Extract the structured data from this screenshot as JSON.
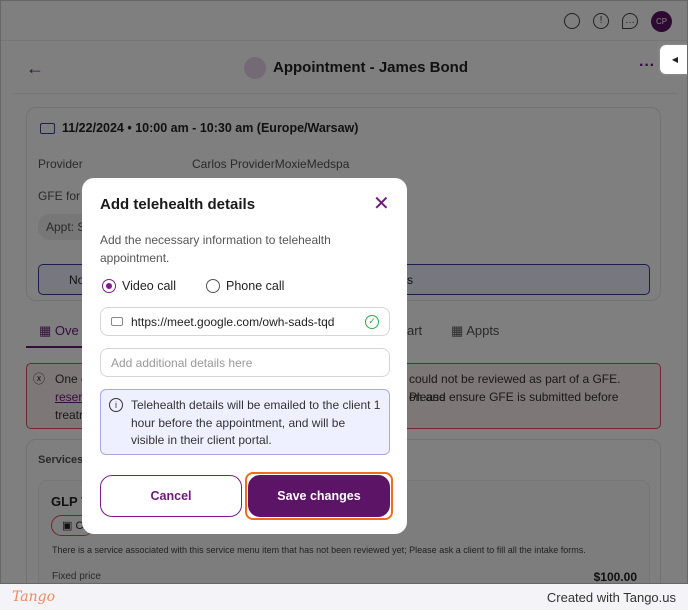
{
  "header": {
    "avatar_initials": "CP",
    "title": "Appointment - James Bond"
  },
  "appointment": {
    "date": "11/22/2024",
    "time": "10:00 am - 10:30 am (Europe/Warsaw)",
    "provider_label": "Provider",
    "provider_value": "Carlos ProviderMoxieMedspa",
    "gfe_label": "GFE for a",
    "appt_chip": "Appt: S",
    "notice_partial": "No",
    "notice_tail": "s"
  },
  "tabs": [
    {
      "label": "Ove"
    },
    {
      "label": "art"
    },
    {
      "label": "Appts"
    }
  ],
  "error": {
    "line1_start": "One c",
    "line1_end": "could not be reviewed as part of a GFE. Please",
    "line2_link": "reser",
    "line2_end": "on and ensure GFE is submitted before",
    "line3": "treatr"
  },
  "services": {
    "heading": "Services &",
    "item": "GLP T",
    "chip": "C",
    "note": "There is a service associated with this service menu item that has not been reviewed yet; Please ask a client to fill all the intake forms.",
    "price_label": "Fixed price",
    "price": "$100.00"
  },
  "modal": {
    "title": "Add telehealth details",
    "description": "Add the necessary information to telehealth appointment.",
    "options": [
      {
        "label": "Video call",
        "selected": true
      },
      {
        "label": "Phone call",
        "selected": false
      }
    ],
    "url_value": "https://meet.google.com/owh-sads-tqd",
    "details_placeholder": "Add additional details here",
    "info": "Telehealth details will be emailed to the client 1 hour before the appointment, and will be visible in their client portal.",
    "cancel_label": "Cancel",
    "save_label": "Save changes"
  },
  "colors": {
    "brand": "#5c1466",
    "highlight": "#f26b21",
    "valid": "#2eaa4a"
  },
  "footer": {
    "logo": "Tango",
    "credit": "Created with Tango.us"
  }
}
